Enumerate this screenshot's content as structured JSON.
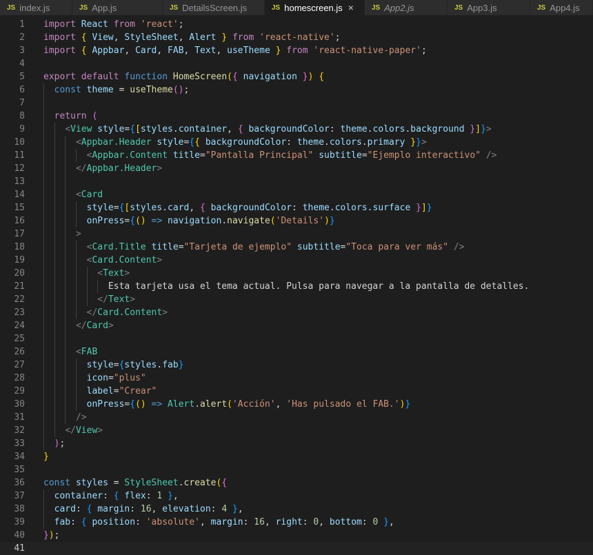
{
  "tabs": [
    {
      "label": "index.js",
      "italic": false,
      "active": false
    },
    {
      "label": "App.js",
      "italic": false,
      "active": false
    },
    {
      "label": "DetailsScreen.js",
      "italic": false,
      "active": false
    },
    {
      "label": "homescreen.js",
      "italic": false,
      "active": true
    },
    {
      "label": "App2.js",
      "italic": true,
      "active": false
    },
    {
      "label": "App3.js",
      "italic": false,
      "active": false
    },
    {
      "label": "App4.js",
      "italic": false,
      "active": false
    }
  ],
  "tab_file_icon": "JS",
  "tab_close_icon": "×",
  "current_line": 41,
  "lines": [
    [
      [
        "ctl",
        "import "
      ],
      [
        "var",
        "React"
      ],
      [
        "ctl",
        " from "
      ],
      [
        "str",
        "'react'"
      ],
      [
        "txt",
        ";"
      ]
    ],
    [
      [
        "ctl",
        "import "
      ],
      [
        "br1",
        "{ "
      ],
      [
        "var",
        "View"
      ],
      [
        "txt",
        ", "
      ],
      [
        "var",
        "StyleSheet"
      ],
      [
        "txt",
        ", "
      ],
      [
        "var",
        "Alert"
      ],
      [
        "br1",
        " }"
      ],
      [
        "ctl",
        " from "
      ],
      [
        "str",
        "'react-native'"
      ],
      [
        "txt",
        ";"
      ]
    ],
    [
      [
        "ctl",
        "import "
      ],
      [
        "br1",
        "{ "
      ],
      [
        "var",
        "Appbar"
      ],
      [
        "txt",
        ", "
      ],
      [
        "var",
        "Card"
      ],
      [
        "txt",
        ", "
      ],
      [
        "var",
        "FAB"
      ],
      [
        "txt",
        ", "
      ],
      [
        "var",
        "Text"
      ],
      [
        "txt",
        ", "
      ],
      [
        "var",
        "useTheme"
      ],
      [
        "br1",
        " }"
      ],
      [
        "ctl",
        " from "
      ],
      [
        "str",
        "'react-native-paper'"
      ],
      [
        "txt",
        ";"
      ]
    ],
    [],
    [
      [
        "ctl",
        "export "
      ],
      [
        "ctl",
        "default "
      ],
      [
        "kw",
        "function "
      ],
      [
        "fn",
        "HomeScreen"
      ],
      [
        "br1",
        "("
      ],
      [
        "br2",
        "{ "
      ],
      [
        "var",
        "navigation"
      ],
      [
        "br2",
        " }"
      ],
      [
        "br1",
        ")"
      ],
      [
        "txt",
        " "
      ],
      [
        "br1",
        "{"
      ]
    ],
    [
      [
        "txt",
        "  "
      ],
      [
        "kw",
        "const "
      ],
      [
        "var",
        "theme"
      ],
      [
        "txt",
        " = "
      ],
      [
        "fn",
        "useTheme"
      ],
      [
        "br2",
        "()"
      ],
      [
        "txt",
        ";"
      ]
    ],
    [],
    [
      [
        "txt",
        "  "
      ],
      [
        "ctl",
        "return "
      ],
      [
        "br2",
        "("
      ]
    ],
    [
      [
        "txt",
        "    "
      ],
      [
        "pun",
        "<"
      ],
      [
        "tag",
        "View"
      ],
      [
        "txt",
        " "
      ],
      [
        "var",
        "style"
      ],
      [
        "txt",
        "="
      ],
      [
        "br3",
        "{"
      ],
      [
        "br1",
        "["
      ],
      [
        "var",
        "styles"
      ],
      [
        "txt",
        "."
      ],
      [
        "var",
        "container"
      ],
      [
        "txt",
        ", "
      ],
      [
        "br2",
        "{ "
      ],
      [
        "var",
        "backgroundColor"
      ],
      [
        "txt",
        ": "
      ],
      [
        "var",
        "theme"
      ],
      [
        "txt",
        "."
      ],
      [
        "var",
        "colors"
      ],
      [
        "txt",
        "."
      ],
      [
        "var",
        "background"
      ],
      [
        "br2",
        " }"
      ],
      [
        "br1",
        "]"
      ],
      [
        "br3",
        "}"
      ],
      [
        "pun",
        ">"
      ]
    ],
    [
      [
        "txt",
        "      "
      ],
      [
        "pun",
        "<"
      ],
      [
        "tag",
        "Appbar.Header"
      ],
      [
        "txt",
        " "
      ],
      [
        "var",
        "style"
      ],
      [
        "txt",
        "="
      ],
      [
        "br3",
        "{"
      ],
      [
        "br1",
        "{ "
      ],
      [
        "var",
        "backgroundColor"
      ],
      [
        "txt",
        ": "
      ],
      [
        "var",
        "theme"
      ],
      [
        "txt",
        "."
      ],
      [
        "var",
        "colors"
      ],
      [
        "txt",
        "."
      ],
      [
        "var",
        "primary"
      ],
      [
        "br1",
        " }"
      ],
      [
        "br3",
        "}"
      ],
      [
        "pun",
        ">"
      ]
    ],
    [
      [
        "txt",
        "        "
      ],
      [
        "pun",
        "<"
      ],
      [
        "tag",
        "Appbar.Content"
      ],
      [
        "txt",
        " "
      ],
      [
        "var",
        "title"
      ],
      [
        "txt",
        "="
      ],
      [
        "str",
        "\"Pantalla Principal\""
      ],
      [
        "txt",
        " "
      ],
      [
        "var",
        "subtitle"
      ],
      [
        "txt",
        "="
      ],
      [
        "str",
        "\"Ejemplo interactivo\""
      ],
      [
        "txt",
        " "
      ],
      [
        "pun",
        "/>"
      ]
    ],
    [
      [
        "txt",
        "      "
      ],
      [
        "pun",
        "</"
      ],
      [
        "tag",
        "Appbar.Header"
      ],
      [
        "pun",
        ">"
      ]
    ],
    [],
    [
      [
        "txt",
        "      "
      ],
      [
        "pun",
        "<"
      ],
      [
        "tag",
        "Card"
      ]
    ],
    [
      [
        "txt",
        "        "
      ],
      [
        "var",
        "style"
      ],
      [
        "txt",
        "="
      ],
      [
        "br3",
        "{"
      ],
      [
        "br1",
        "["
      ],
      [
        "var",
        "styles"
      ],
      [
        "txt",
        "."
      ],
      [
        "var",
        "card"
      ],
      [
        "txt",
        ", "
      ],
      [
        "br2",
        "{ "
      ],
      [
        "var",
        "backgroundColor"
      ],
      [
        "txt",
        ": "
      ],
      [
        "var",
        "theme"
      ],
      [
        "txt",
        "."
      ],
      [
        "var",
        "colors"
      ],
      [
        "txt",
        "."
      ],
      [
        "var",
        "surface"
      ],
      [
        "br2",
        " }"
      ],
      [
        "br1",
        "]"
      ],
      [
        "br3",
        "}"
      ]
    ],
    [
      [
        "txt",
        "        "
      ],
      [
        "var",
        "onPress"
      ],
      [
        "txt",
        "="
      ],
      [
        "br3",
        "{"
      ],
      [
        "br1",
        "()"
      ],
      [
        "kw",
        " => "
      ],
      [
        "var",
        "navigation"
      ],
      [
        "txt",
        "."
      ],
      [
        "fn",
        "navigate"
      ],
      [
        "br1",
        "("
      ],
      [
        "str",
        "'Details'"
      ],
      [
        "br1",
        ")"
      ],
      [
        "br3",
        "}"
      ]
    ],
    [
      [
        "txt",
        "      "
      ],
      [
        "pun",
        ">"
      ]
    ],
    [
      [
        "txt",
        "        "
      ],
      [
        "pun",
        "<"
      ],
      [
        "tag",
        "Card.Title"
      ],
      [
        "txt",
        " "
      ],
      [
        "var",
        "title"
      ],
      [
        "txt",
        "="
      ],
      [
        "str",
        "\"Tarjeta de ejemplo\""
      ],
      [
        "txt",
        " "
      ],
      [
        "var",
        "subtitle"
      ],
      [
        "txt",
        "="
      ],
      [
        "str",
        "\"Toca para ver más\""
      ],
      [
        "txt",
        " "
      ],
      [
        "pun",
        "/>"
      ]
    ],
    [
      [
        "txt",
        "        "
      ],
      [
        "pun",
        "<"
      ],
      [
        "tag",
        "Card.Content"
      ],
      [
        "pun",
        ">"
      ]
    ],
    [
      [
        "txt",
        "          "
      ],
      [
        "pun",
        "<"
      ],
      [
        "tag",
        "Text"
      ],
      [
        "pun",
        ">"
      ]
    ],
    [
      [
        "txt",
        "            Esta tarjeta usa el tema actual. Pulsa para navegar a la pantalla de detalles."
      ]
    ],
    [
      [
        "txt",
        "          "
      ],
      [
        "pun",
        "</"
      ],
      [
        "tag",
        "Text"
      ],
      [
        "pun",
        ">"
      ]
    ],
    [
      [
        "txt",
        "        "
      ],
      [
        "pun",
        "</"
      ],
      [
        "tag",
        "Card.Content"
      ],
      [
        "pun",
        ">"
      ]
    ],
    [
      [
        "txt",
        "      "
      ],
      [
        "pun",
        "</"
      ],
      [
        "tag",
        "Card"
      ],
      [
        "pun",
        ">"
      ]
    ],
    [],
    [
      [
        "txt",
        "      "
      ],
      [
        "pun",
        "<"
      ],
      [
        "tag",
        "FAB"
      ]
    ],
    [
      [
        "txt",
        "        "
      ],
      [
        "var",
        "style"
      ],
      [
        "txt",
        "="
      ],
      [
        "br3",
        "{"
      ],
      [
        "var",
        "styles"
      ],
      [
        "txt",
        "."
      ],
      [
        "var",
        "fab"
      ],
      [
        "br3",
        "}"
      ]
    ],
    [
      [
        "txt",
        "        "
      ],
      [
        "var",
        "icon"
      ],
      [
        "txt",
        "="
      ],
      [
        "str",
        "\"plus\""
      ]
    ],
    [
      [
        "txt",
        "        "
      ],
      [
        "var",
        "label"
      ],
      [
        "txt",
        "="
      ],
      [
        "str",
        "\"Crear\""
      ]
    ],
    [
      [
        "txt",
        "        "
      ],
      [
        "var",
        "onPress"
      ],
      [
        "txt",
        "="
      ],
      [
        "br3",
        "{"
      ],
      [
        "br1",
        "()"
      ],
      [
        "kw",
        " => "
      ],
      [
        "cls",
        "Alert"
      ],
      [
        "txt",
        "."
      ],
      [
        "fn",
        "alert"
      ],
      [
        "br1",
        "("
      ],
      [
        "str",
        "'Acción'"
      ],
      [
        "txt",
        ", "
      ],
      [
        "str",
        "'Has pulsado el FAB.'"
      ],
      [
        "br1",
        ")"
      ],
      [
        "br3",
        "}"
      ]
    ],
    [
      [
        "txt",
        "      "
      ],
      [
        "pun",
        "/>"
      ]
    ],
    [
      [
        "txt",
        "    "
      ],
      [
        "pun",
        "</"
      ],
      [
        "tag",
        "View"
      ],
      [
        "pun",
        ">"
      ]
    ],
    [
      [
        "txt",
        "  "
      ],
      [
        "br2",
        ")"
      ],
      [
        "txt",
        ";"
      ]
    ],
    [
      [
        "br1",
        "}"
      ]
    ],
    [],
    [
      [
        "kw",
        "const "
      ],
      [
        "var",
        "styles"
      ],
      [
        "txt",
        " = "
      ],
      [
        "cls",
        "StyleSheet"
      ],
      [
        "txt",
        "."
      ],
      [
        "fn",
        "create"
      ],
      [
        "br1",
        "("
      ],
      [
        "br2",
        "{"
      ]
    ],
    [
      [
        "txt",
        "  "
      ],
      [
        "var",
        "container"
      ],
      [
        "txt",
        ": "
      ],
      [
        "br3",
        "{ "
      ],
      [
        "var",
        "flex"
      ],
      [
        "txt",
        ": "
      ],
      [
        "num",
        "1"
      ],
      [
        "br3",
        " }"
      ],
      [
        "txt",
        ","
      ]
    ],
    [
      [
        "txt",
        "  "
      ],
      [
        "var",
        "card"
      ],
      [
        "txt",
        ": "
      ],
      [
        "br3",
        "{ "
      ],
      [
        "var",
        "margin"
      ],
      [
        "txt",
        ": "
      ],
      [
        "num",
        "16"
      ],
      [
        "txt",
        ", "
      ],
      [
        "var",
        "elevation"
      ],
      [
        "txt",
        ": "
      ],
      [
        "num",
        "4"
      ],
      [
        "br3",
        " }"
      ],
      [
        "txt",
        ","
      ]
    ],
    [
      [
        "txt",
        "  "
      ],
      [
        "var",
        "fab"
      ],
      [
        "txt",
        ": "
      ],
      [
        "br3",
        "{ "
      ],
      [
        "var",
        "position"
      ],
      [
        "txt",
        ": "
      ],
      [
        "str",
        "'absolute'"
      ],
      [
        "txt",
        ", "
      ],
      [
        "var",
        "margin"
      ],
      [
        "txt",
        ": "
      ],
      [
        "num",
        "16"
      ],
      [
        "txt",
        ", "
      ],
      [
        "var",
        "right"
      ],
      [
        "txt",
        ": "
      ],
      [
        "num",
        "0"
      ],
      [
        "txt",
        ", "
      ],
      [
        "var",
        "bottom"
      ],
      [
        "txt",
        ": "
      ],
      [
        "num",
        "0"
      ],
      [
        "br3",
        " }"
      ],
      [
        "txt",
        ","
      ]
    ],
    [
      [
        "br2",
        "}"
      ],
      [
        "br1",
        ")"
      ],
      [
        "txt",
        ";"
      ]
    ],
    []
  ]
}
